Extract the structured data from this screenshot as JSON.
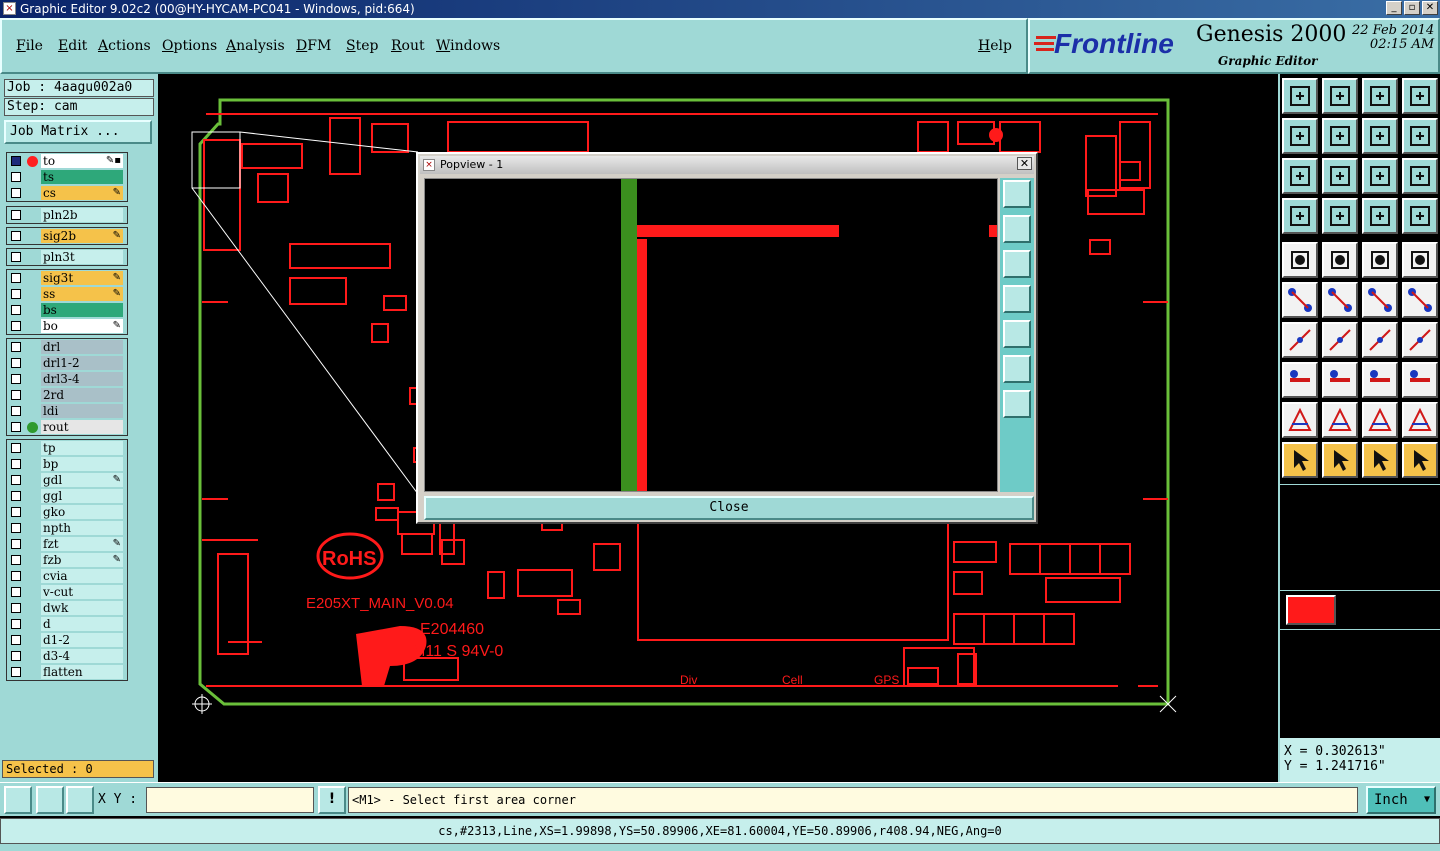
{
  "window": {
    "title": "Graphic Editor 9.02c2 (00@HY-HYCAM-PC041 - Windows, pid:664)",
    "minimize": "_",
    "maximize": "▫",
    "close": "✕"
  },
  "menu": {
    "items": [
      "File",
      "Edit",
      "Actions",
      "Options",
      "Analysis",
      "DFM",
      "Step",
      "Rout",
      "Windows"
    ],
    "help": "Help"
  },
  "brand": {
    "logo": "Frontline",
    "product": "Genesis 2000",
    "module": "Graphic Editor",
    "date": "22 Feb 2014",
    "time": "02:15 AM"
  },
  "job": {
    "job_label": "Job : 4aagu002a0",
    "step_label": "Step: cam",
    "matrix_button": "Job Matrix ..."
  },
  "layers": {
    "group1": [
      {
        "name": "to",
        "color": "#ffffff",
        "dot": "#ff2020",
        "mark": "✎▪",
        "checked": true
      },
      {
        "name": "ts",
        "color": "#2ea87a",
        "dot": "",
        "mark": ""
      },
      {
        "name": "cs",
        "color": "#f5c24a",
        "dot": "",
        "mark": "✎"
      }
    ],
    "group2": [
      {
        "name": "pln2b",
        "color": "#c6efec",
        "dot": "",
        "mark": ""
      }
    ],
    "group3": [
      {
        "name": "sig2b",
        "color": "#f5c24a",
        "dot": "",
        "mark": "✎"
      }
    ],
    "group4": [
      {
        "name": "pln3t",
        "color": "#c6efec",
        "dot": "",
        "mark": ""
      }
    ],
    "group5": [
      {
        "name": "sig3t",
        "color": "#f5c24a",
        "dot": "",
        "mark": "✎"
      },
      {
        "name": "ss",
        "color": "#f5c24a",
        "dot": "",
        "mark": "✎"
      },
      {
        "name": "bs",
        "color": "#2ea87a",
        "dot": "",
        "mark": ""
      },
      {
        "name": "bo",
        "color": "#ffffff",
        "dot": "",
        "mark": "✎"
      }
    ],
    "group6": [
      {
        "name": "drl",
        "color": "#a9c0c8",
        "dot": "",
        "mark": ""
      },
      {
        "name": "drl1-2",
        "color": "#a9c0c8",
        "dot": "",
        "mark": ""
      },
      {
        "name": "drl3-4",
        "color": "#a9c0c8",
        "dot": "",
        "mark": ""
      },
      {
        "name": "2rd",
        "color": "#a9c0c8",
        "dot": "",
        "mark": ""
      },
      {
        "name": "ldi",
        "color": "#a9c0c8",
        "dot": "",
        "mark": ""
      },
      {
        "name": "rout",
        "color": "#e6e6e6",
        "dot": "#2f9a2f",
        "mark": ""
      }
    ],
    "group7": [
      {
        "name": "tp",
        "color": "#c6efec",
        "dot": "",
        "mark": ""
      },
      {
        "name": "bp",
        "color": "#c6efec",
        "dot": "",
        "mark": ""
      },
      {
        "name": "gdl",
        "color": "#c6efec",
        "dot": "",
        "mark": "✎"
      },
      {
        "name": "ggl",
        "color": "#c6efec",
        "dot": "",
        "mark": ""
      },
      {
        "name": "gko",
        "color": "#c6efec",
        "dot": "",
        "mark": ""
      },
      {
        "name": "npth",
        "color": "#c6efec",
        "dot": "",
        "mark": ""
      },
      {
        "name": "fzt",
        "color": "#c6efec",
        "dot": "",
        "mark": "✎"
      },
      {
        "name": "fzb",
        "color": "#c6efec",
        "dot": "",
        "mark": "✎"
      },
      {
        "name": "cvia",
        "color": "#c6efec",
        "dot": "",
        "mark": ""
      },
      {
        "name": "v-cut",
        "color": "#c6efec",
        "dot": "",
        "mark": ""
      },
      {
        "name": "dwk",
        "color": "#c6efec",
        "dot": "",
        "mark": ""
      },
      {
        "name": "d",
        "color": "#c6efec",
        "dot": "",
        "mark": ""
      },
      {
        "name": "d1-2",
        "color": "#c6efec",
        "dot": "",
        "mark": ""
      },
      {
        "name": "d3-4",
        "color": "#c6efec",
        "dot": "",
        "mark": ""
      },
      {
        "name": "flatten",
        "color": "#c6efec",
        "dot": "",
        "mark": ""
      }
    ]
  },
  "selected": "Selected : 0",
  "board_text": {
    "rohs": "RoHS",
    "main": "E205XT_MAIN_V0.04",
    "ul_code": "E204460",
    "ul_rating": "M11 S 94V-0",
    "div": "Div",
    "cell": "Cell",
    "gps": "GPS"
  },
  "popview": {
    "title": "Popview - 1",
    "close_label": "Close",
    "x": "✕"
  },
  "coords": {
    "x": "X = 0.302613\"",
    "y": "Y = 1.241716\""
  },
  "bottom": {
    "xy_label": "X Y :",
    "xy_value": "",
    "warn": "!",
    "prompt": "<M1> - Select first area corner",
    "unit": "Inch"
  },
  "status": "cs,#2313,Line,XS=1.99898,YS=50.89906,XE=81.60004,YE=50.89906,r408.94,NEG,Ang=0",
  "colors": {
    "board_outline": "#6abf3a",
    "copper": "#ff1a1a",
    "ui_cyan": "#9fd9d6"
  }
}
